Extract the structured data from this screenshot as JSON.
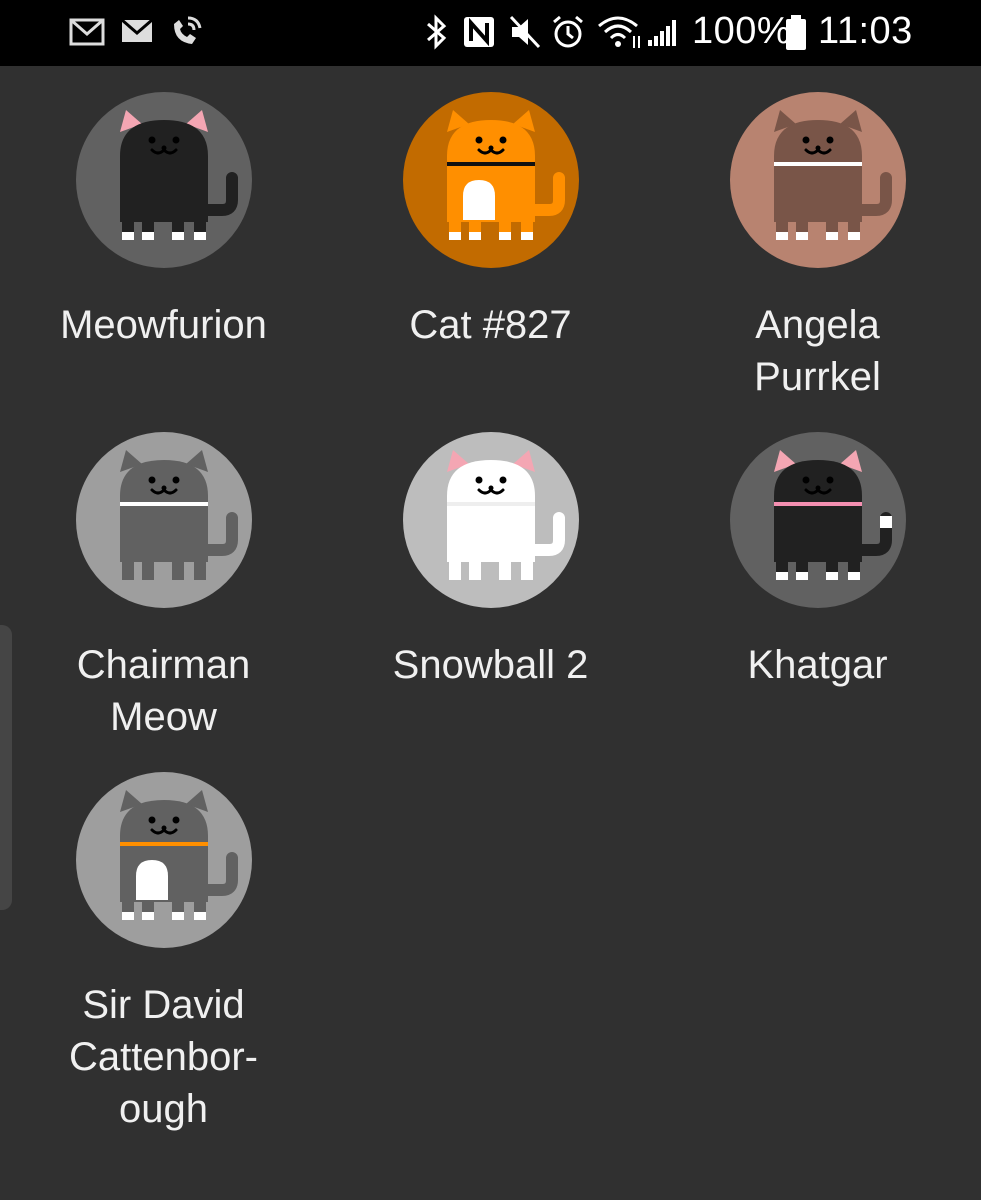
{
  "status_bar": {
    "left_icons": [
      "gallery-mail-icon",
      "mail-icon",
      "wifi-call-icon"
    ],
    "right_icons": [
      "bluetooth-icon",
      "nfc-icon",
      "mute-icon",
      "alarm-icon",
      "wifi-icon",
      "signal-icon",
      "battery-icon"
    ],
    "battery_percent": "100%",
    "time": "11:03"
  },
  "cats": [
    {
      "name": "Meowfurion",
      "bg": "#616161",
      "body": "#212121",
      "ears": "#f4a6b3",
      "collar": "#212121",
      "belly": null,
      "paws": "#ffffff",
      "tail_tip": null
    },
    {
      "name": "Cat #827",
      "bg": "#c26b00",
      "body": "#ff8f00",
      "ears": "#ff8f00",
      "collar": "#111111",
      "belly": "#ffffff",
      "paws": "#ffffff",
      "tail_tip": null
    },
    {
      "name": "Angela\nPurrkel",
      "bg": "#b88370",
      "body": "#795548",
      "ears": "#795548",
      "collar": "#ffffff",
      "belly": null,
      "paws": "#ffffff",
      "tail_tip": null
    },
    {
      "name": "Chairman\nMeow",
      "bg": "#9e9e9e",
      "body": "#616161",
      "ears": "#616161",
      "collar": "#ffffff",
      "belly": null,
      "paws": "#616161",
      "tail_tip": null
    },
    {
      "name": "Snowball 2",
      "bg": "#bdbdbd",
      "body": "#ffffff",
      "ears": "#f4a6b3",
      "collar": "#eeeeee",
      "belly": null,
      "paws": "#ffffff",
      "tail_tip": null
    },
    {
      "name": "Khatgar",
      "bg": "#616161",
      "body": "#212121",
      "ears": "#f4a6b3",
      "collar": "#f48fb1",
      "belly": null,
      "paws": "#ffffff",
      "tail_tip": "#ffffff"
    },
    {
      "name": "Sir David\nCattenbor-\nough",
      "bg": "#9e9e9e",
      "body": "#616161",
      "ears": "#616161",
      "collar": "#ff8f00",
      "belly": "#ffffff",
      "paws": "#ffffff",
      "tail_tip": null
    }
  ]
}
